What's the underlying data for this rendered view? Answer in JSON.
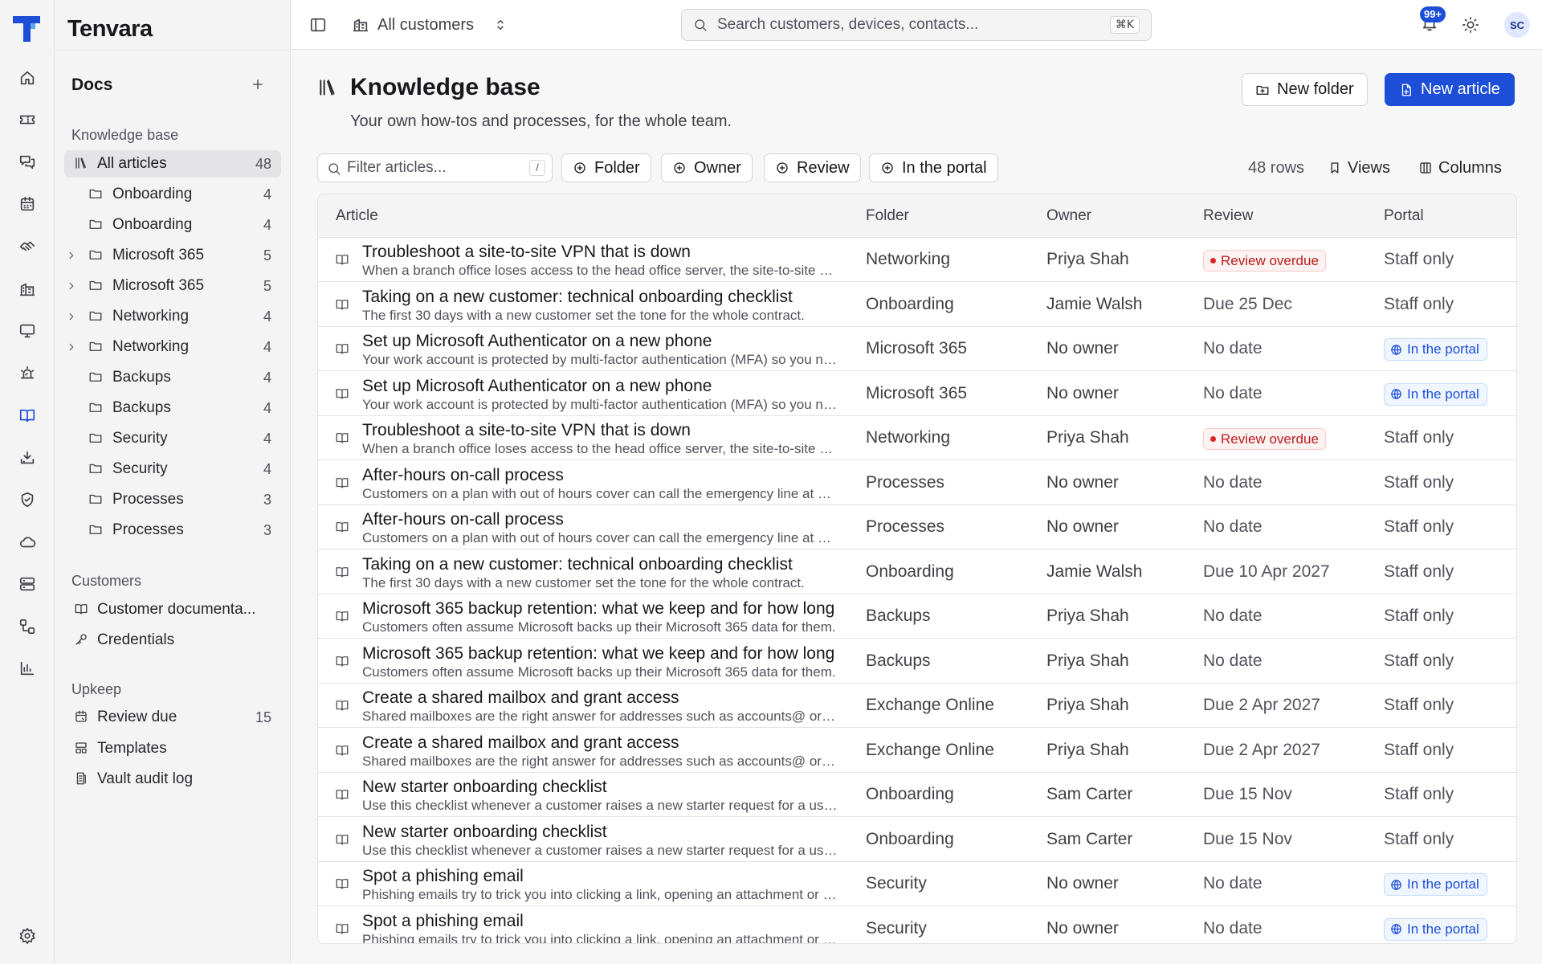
{
  "app": {
    "name": "Tenvara"
  },
  "topbar": {
    "customer_switch": "All customers",
    "search_placeholder": "Search customers, devices, contacts...",
    "search_shortcut": "⌘K",
    "notifications": "99+",
    "avatar": "SC"
  },
  "rail": {
    "icons": [
      "home-icon",
      "ticket-icon",
      "chat-icon",
      "calendar-icon",
      "handshake-icon",
      "building-icon",
      "monitor-icon",
      "alert-icon",
      "book-icon",
      "download-icon",
      "shield-icon",
      "cloud-icon",
      "server-icon",
      "workflow-icon",
      "chart-icon",
      "settings-icon"
    ],
    "active": "book-icon"
  },
  "sidebar": {
    "title": "Docs",
    "sections": {
      "knowledge_base": "Knowledge base",
      "customers": "Customers",
      "upkeep": "Upkeep"
    },
    "kb_items": [
      {
        "label": "All articles",
        "count": "48"
      },
      {
        "label": "Onboarding",
        "count": "4"
      },
      {
        "label": "Onboarding",
        "count": "4"
      },
      {
        "label": "Microsoft 365",
        "count": "5"
      },
      {
        "label": "Microsoft 365",
        "count": "5"
      },
      {
        "label": "Networking",
        "count": "4"
      },
      {
        "label": "Networking",
        "count": "4"
      },
      {
        "label": "Backups",
        "count": "4"
      },
      {
        "label": "Backups",
        "count": "4"
      },
      {
        "label": "Security",
        "count": "4"
      },
      {
        "label": "Security",
        "count": "4"
      },
      {
        "label": "Processes",
        "count": "3"
      },
      {
        "label": "Processes",
        "count": "3"
      }
    ],
    "customer_items": [
      {
        "label": "Customer documenta..."
      },
      {
        "label": "Credentials"
      }
    ],
    "upkeep_items": [
      {
        "label": "Review due",
        "count": "15"
      },
      {
        "label": "Templates"
      },
      {
        "label": "Vault audit log"
      }
    ]
  },
  "page": {
    "title": "Knowledge base",
    "subtitle": "Your own how-tos and processes, for the whole team.",
    "new_folder": "New folder",
    "new_article": "New article"
  },
  "toolbar": {
    "filter_placeholder": "Filter articles...",
    "filter_shortcut": "/",
    "chips": [
      "Folder",
      "Owner",
      "Review",
      "In the portal"
    ],
    "rows_count": "48 rows",
    "views": "Views",
    "columns": "Columns"
  },
  "table": {
    "headers": [
      "Article",
      "Folder",
      "Owner",
      "Review",
      "Portal"
    ],
    "rows": [
      {
        "title": "Troubleshoot a site-to-site VPN that is down",
        "desc": "When a branch office loses access to the head office server, the site-to-site VPN is usually the cause.",
        "folder": "Networking",
        "owner": "Priya Shah",
        "review": "Review overdue",
        "review_type": "overdue",
        "portal": "Staff only",
        "portal_type": "staff"
      },
      {
        "title": "Taking on a new customer: technical onboarding checklist",
        "desc": "The first 30 days with a new customer set the tone for the whole contract.",
        "folder": "Onboarding",
        "owner": "Jamie Walsh",
        "review": "Due 25 Dec",
        "review_type": "text",
        "portal": "Staff only",
        "portal_type": "staff"
      },
      {
        "title": "Set up Microsoft Authenticator on a new phone",
        "desc": "Your work account is protected by multi-factor authentication (MFA) so you need the app on your new phone.",
        "folder": "Microsoft 365",
        "owner": "No owner",
        "review": "No date",
        "review_type": "text",
        "portal": "In the portal",
        "portal_type": "portal"
      },
      {
        "title": "Set up Microsoft Authenticator on a new phone",
        "desc": "Your work account is protected by multi-factor authentication (MFA) so you need the app on your new phone.",
        "folder": "Microsoft 365",
        "owner": "No owner",
        "review": "No date",
        "review_type": "text",
        "portal": "In the portal",
        "portal_type": "portal"
      },
      {
        "title": "Troubleshoot a site-to-site VPN that is down",
        "desc": "When a branch office loses access to the head office server, the site-to-site VPN is usually the cause.",
        "folder": "Networking",
        "owner": "Priya Shah",
        "review": "Review overdue",
        "review_type": "overdue",
        "portal": "Staff only",
        "portal_type": "staff"
      },
      {
        "title": "After-hours on-call process",
        "desc": "Customers on a plan with out of hours cover can call the emergency line at any time.",
        "folder": "Processes",
        "owner": "No owner",
        "review": "No date",
        "review_type": "text",
        "portal": "Staff only",
        "portal_type": "staff"
      },
      {
        "title": "After-hours on-call process",
        "desc": "Customers on a plan with out of hours cover can call the emergency line at any time.",
        "folder": "Processes",
        "owner": "No owner",
        "review": "No date",
        "review_type": "text",
        "portal": "Staff only",
        "portal_type": "staff"
      },
      {
        "title": "Taking on a new customer: technical onboarding checklist",
        "desc": "The first 30 days with a new customer set the tone for the whole contract.",
        "folder": "Onboarding",
        "owner": "Jamie Walsh",
        "review": "Due 10 Apr 2027",
        "review_type": "text",
        "portal": "Staff only",
        "portal_type": "staff"
      },
      {
        "title": "Microsoft 365 backup retention: what we keep and for how long",
        "desc": "Customers often assume Microsoft backs up their Microsoft 365 data for them.",
        "folder": "Backups",
        "owner": "Priya Shah",
        "review": "No date",
        "review_type": "text",
        "portal": "Staff only",
        "portal_type": "staff"
      },
      {
        "title": "Microsoft 365 backup retention: what we keep and for how long",
        "desc": "Customers often assume Microsoft backs up their Microsoft 365 data for them.",
        "folder": "Backups",
        "owner": "Priya Shah",
        "review": "No date",
        "review_type": "text",
        "portal": "Staff only",
        "portal_type": "staff"
      },
      {
        "title": "Create a shared mailbox and grant access",
        "desc": "Shared mailboxes are the right answer for addresses such as accounts@ or info@.",
        "folder": "Exchange Online",
        "owner": "Priya Shah",
        "review": "Due 2 Apr 2027",
        "review_type": "text",
        "portal": "Staff only",
        "portal_type": "staff"
      },
      {
        "title": "Create a shared mailbox and grant access",
        "desc": "Shared mailboxes are the right answer for addresses such as accounts@ or info@.",
        "folder": "Exchange Online",
        "owner": "Priya Shah",
        "review": "Due 2 Apr 2027",
        "review_type": "text",
        "portal": "Staff only",
        "portal_type": "staff"
      },
      {
        "title": "New starter onboarding checklist",
        "desc": "Use this checklist whenever a customer raises a new starter request for a user.",
        "folder": "Onboarding",
        "owner": "Sam Carter",
        "review": "Due 15 Nov",
        "review_type": "text",
        "portal": "Staff only",
        "portal_type": "staff"
      },
      {
        "title": "New starter onboarding checklist",
        "desc": "Use this checklist whenever a customer raises a new starter request for a user.",
        "folder": "Onboarding",
        "owner": "Sam Carter",
        "review": "Due 15 Nov",
        "review_type": "text",
        "portal": "Staff only",
        "portal_type": "staff"
      },
      {
        "title": "Spot a phishing email",
        "desc": "Phishing emails try to trick you into clicking a link, opening an attachment or sharing details.",
        "folder": "Security",
        "owner": "No owner",
        "review": "No date",
        "review_type": "text",
        "portal": "In the portal",
        "portal_type": "portal"
      },
      {
        "title": "Spot a phishing email",
        "desc": "Phishing emails try to trick you into clicking a link, opening an attachment or sharing details.",
        "folder": "Security",
        "owner": "No owner",
        "review": "No date",
        "review_type": "text",
        "portal": "In the portal",
        "portal_type": "portal"
      }
    ]
  },
  "colors": {
    "accent": "#1d4ed8",
    "danger": "#b91c1c",
    "portal": "#1d4ed8"
  }
}
